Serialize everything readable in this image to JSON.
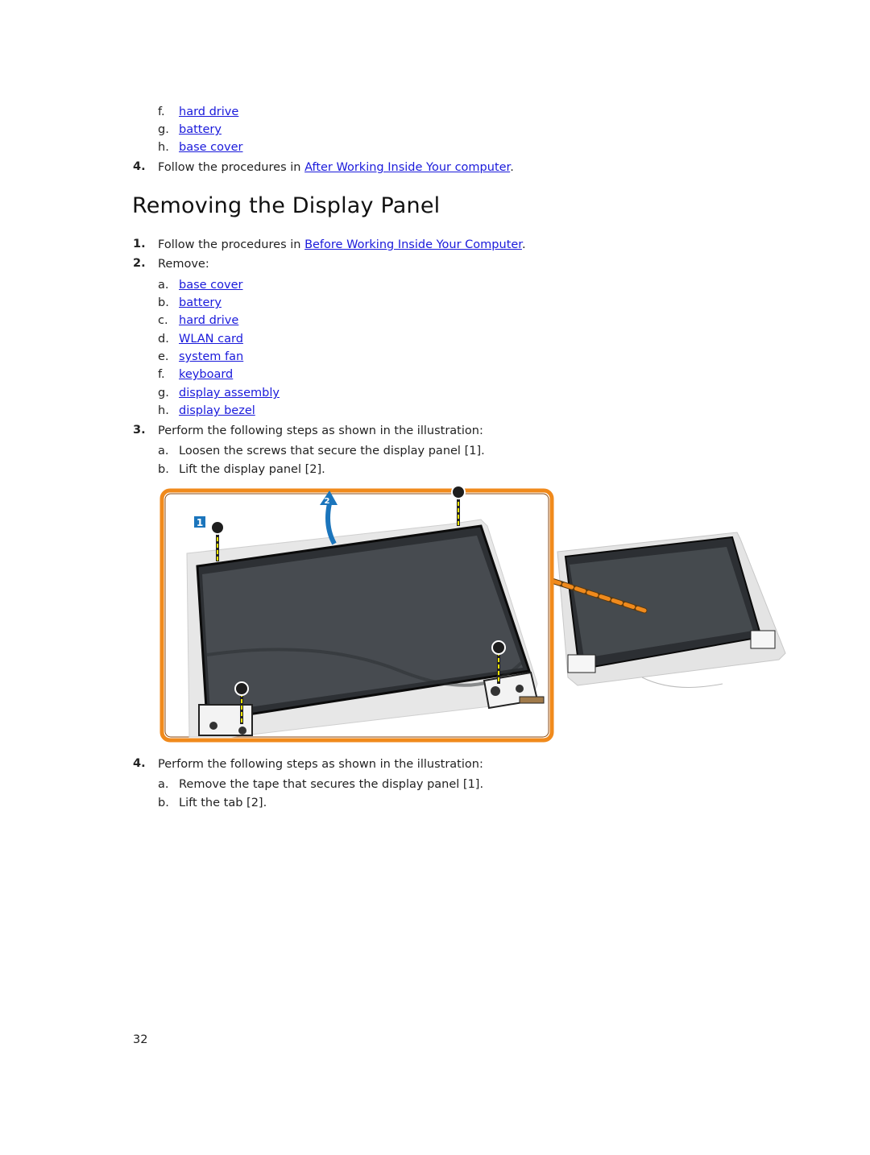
{
  "continued_list": {
    "items": [
      {
        "label": "f.",
        "link": "hard drive"
      },
      {
        "label": "g.",
        "link": "battery"
      },
      {
        "label": "h.",
        "link": "base cover"
      }
    ],
    "step4": {
      "number": "4.",
      "text": "Follow the procedures in ",
      "link": "After Working Inside Your computer",
      "suffix": "."
    }
  },
  "section": {
    "title": "Removing the Display Panel",
    "step1": {
      "number": "1.",
      "text": "Follow the procedures in ",
      "link": "Before Working Inside Your Computer",
      "suffix": "."
    },
    "step2": {
      "number": "2.",
      "text": "Remove:",
      "items": [
        {
          "label": "a.",
          "link": "base cover"
        },
        {
          "label": "b.",
          "link": "battery"
        },
        {
          "label": "c.",
          "link": "hard drive"
        },
        {
          "label": "d.",
          "link": "WLAN card"
        },
        {
          "label": "e.",
          "link": "system fan"
        },
        {
          "label": "f.",
          "link": "keyboard"
        },
        {
          "label": "g.",
          "link": "display assembly"
        },
        {
          "label": "h.",
          "link": "display bezel"
        }
      ]
    },
    "step3": {
      "number": "3.",
      "text": "Perform the following steps as shown in the illustration:",
      "substeps": [
        {
          "label": "a.",
          "text": "Loosen the screws that secure the display panel [1]."
        },
        {
          "label": "b.",
          "text": "Lift the display panel [2]."
        }
      ]
    },
    "illustration": {
      "callout_1": "1",
      "callout_2": "2",
      "colors": {
        "frame": "#f08a1c",
        "callout": "#1b75bc",
        "screen": "#3c3f42",
        "screw_line": "#f3e600"
      }
    },
    "step4": {
      "number": "4.",
      "text": "Perform the following steps as shown in the illustration:",
      "substeps": [
        {
          "label": "a.",
          "text": "Remove the tape that secures the display panel [1]."
        },
        {
          "label": "b.",
          "text": "Lift the tab [2]."
        }
      ]
    }
  },
  "page_number": "32"
}
